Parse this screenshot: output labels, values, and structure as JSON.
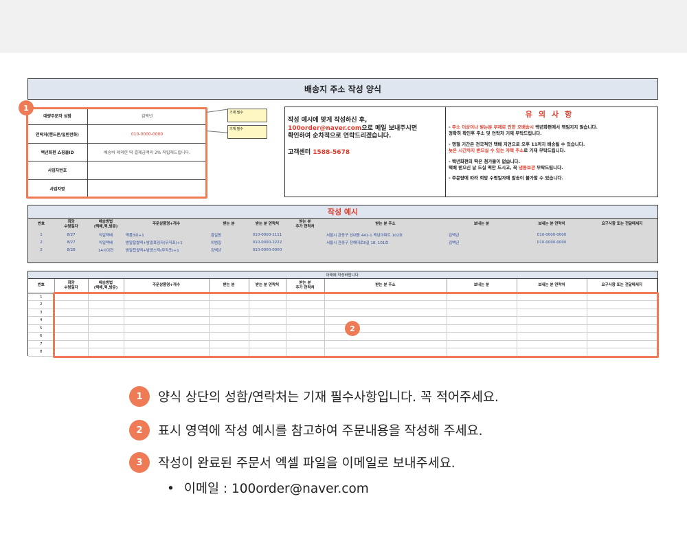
{
  "form": {
    "title": "배송지 주소 작성 양식",
    "info_rows": [
      {
        "label": "대량주문자 성함",
        "value": "김백년",
        "red": false
      },
      {
        "label": "연락처(핸드폰/일반전화)",
        "value": "010-0000-0000",
        "red": true
      },
      {
        "label": "백년화편 쇼핑몰ID",
        "value": "배송비 제외한 떡 결제금액의 2% 적립해드립니다.",
        "red": false
      },
      {
        "label": "사업자번호",
        "value": "",
        "red": false
      },
      {
        "label": "사업자명",
        "value": "",
        "red": false
      }
    ],
    "note_required_1": "기재 필수",
    "note_required_2": "기재 필수",
    "email_box": {
      "line1": "작성 예시에 맞게 작성하신 후,",
      "email": "100order@naver.com",
      "line2_rest": "으로 메일 보내주시면",
      "line3": "확인하여 순차적으로 연락드리겠습니다.",
      "cs_label": "고객센터",
      "cs_number": "1588-5678"
    },
    "notice": {
      "title": "유의사항",
      "item1_prefix": "- ",
      "item1_red": "주소 이상이나 받는분 부재로 인한 오배송시",
      "item1_rest": " 백년화편에서 책임지지 않습니다.",
      "item1_line2": "정확히 확인후 주소 및 연락처 기재 부탁드립니다.",
      "item2_line1": "- 명절 기간은 전국적인 택배 지연으로 오후 11까지 배송될 수 있습니다.",
      "item2_red": "늦은 시간까지 받으실 수 있는 자택 주소",
      "item2_rest": "로 기재 부탁드립니다.",
      "item3_line1": "- 백년화편의 떡은 첨가물이 없습니다.",
      "item3_pre": "택배 받으신 날 드실 떡만 드시고, 꼭 ",
      "item3_red": "냉동보관",
      "item3_post": " 부탁드립니다.",
      "item4": "- 주문량에 따라 희망 수령일자에 발송이 불가할 수 있습니다."
    },
    "example": {
      "title": "작성 예시",
      "headers": [
        "번호",
        "희망\n수령일자",
        "배송방법\n(택배,퀵,방문)",
        "주문상품명+개수",
        "받는 분",
        "받는 분 연락처",
        "받는 분\n추가 연락처",
        "받는 분 주소",
        "보내는 분",
        "보내는 분 연락처",
        "요구사항 또는 전달메세지"
      ],
      "rows": [
        [
          "1",
          "8/27",
          "익일택배",
          "떡품3호+1",
          "홍길동",
          "010-0000-1111",
          "",
          "서울시 관동구 선내동 441-1 백년아파트 102호",
          "김백년",
          "010-0000-0000",
          ""
        ],
        [
          "2",
          "8/27",
          "익일택배",
          "밤말찹쌀떡+밤말흑임자(무직포)+1",
          "이범일",
          "010-0000-2222",
          "",
          "서울시 관동구 전해대로8길 18, 101호",
          "김백년",
          "010-0000-0000",
          ""
        ],
        [
          "2",
          "8/28",
          "14시이전",
          "밤말찹쌀떡+밤콩스틱(무직포)+1",
          "김백년",
          "010-0000-0000",
          "",
          "",
          "",
          "",
          ""
        ]
      ]
    },
    "input": {
      "title": "아래에 작성바랍니다.",
      "row_numbers": [
        "1",
        "2",
        "3",
        "4",
        "5",
        "6",
        "7",
        "8"
      ]
    }
  },
  "badges": {
    "b1": "1",
    "b2": "2"
  },
  "instructions": [
    {
      "num": "1",
      "text": "양식 상단의 성함/연락처는 기재 필수사항입니다. 꼭 적어주세요."
    },
    {
      "num": "2",
      "text": "표시 영역에 작성 예시를 참고하여 주문내용을 작성해 주세요."
    },
    {
      "num": "3",
      "text": "작성이 완료된 주문서 엑셀 파일을 이메일로 보내주세요."
    }
  ],
  "email_note": {
    "bullet": "•",
    "text": "이메일 : 100order@naver.com"
  },
  "colors": {
    "accent": "#ee7b55",
    "red_text": "#e03b2b",
    "header_blue": "#dfe6f0"
  }
}
